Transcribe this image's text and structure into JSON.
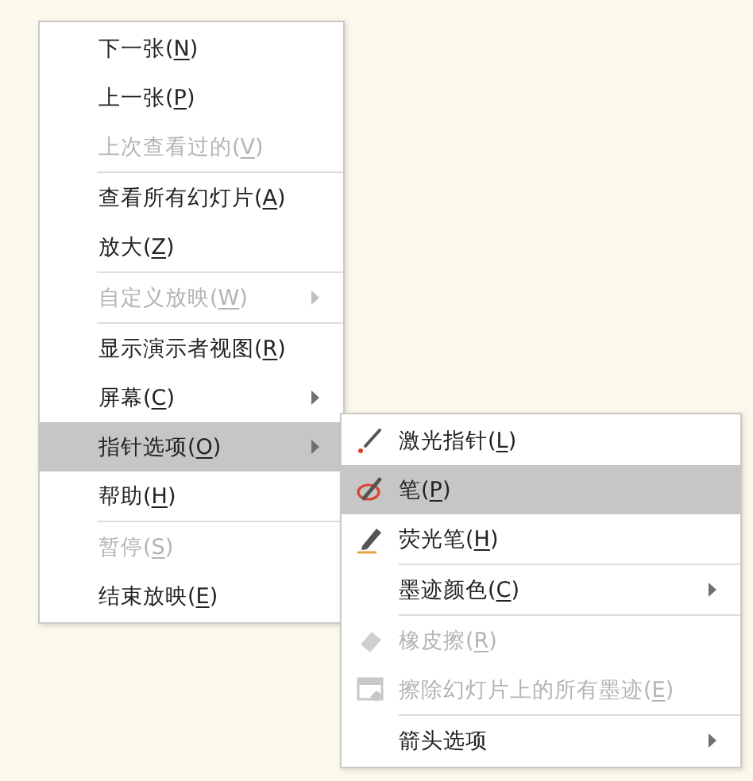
{
  "menu": {
    "items": [
      {
        "label": "下一张(N)",
        "disabled": false,
        "selected": false,
        "submenu": false
      },
      {
        "label": "上一张(P)",
        "disabled": false,
        "selected": false,
        "submenu": false
      },
      {
        "label": "上次查看过的(V)",
        "disabled": true,
        "selected": false,
        "submenu": false,
        "separator_after": true
      },
      {
        "label": "查看所有幻灯片(A)",
        "disabled": false,
        "selected": false,
        "submenu": false
      },
      {
        "label": "放大(Z)",
        "disabled": false,
        "selected": false,
        "submenu": false,
        "separator_after": true
      },
      {
        "label": "自定义放映(W)",
        "disabled": true,
        "selected": false,
        "submenu": true,
        "separator_after": true
      },
      {
        "label": "显示演示者视图(R)",
        "disabled": false,
        "selected": false,
        "submenu": false
      },
      {
        "label": "屏幕(C)",
        "disabled": false,
        "selected": false,
        "submenu": true
      },
      {
        "label": "指针选项(O)",
        "disabled": false,
        "selected": true,
        "submenu": true
      },
      {
        "label": "帮助(H)",
        "disabled": false,
        "selected": false,
        "submenu": false,
        "separator_after": true
      },
      {
        "label": "暂停(S)",
        "disabled": true,
        "selected": false,
        "submenu": false
      },
      {
        "label": "结束放映(E)",
        "disabled": false,
        "selected": false,
        "submenu": false
      }
    ]
  },
  "submenu": {
    "items": [
      {
        "kind": "laser",
        "label": "激光指针(L)",
        "disabled": false,
        "selected": false,
        "submenu": false
      },
      {
        "kind": "pen",
        "label": "笔(P)",
        "disabled": false,
        "selected": true,
        "submenu": false
      },
      {
        "kind": "highlighter",
        "label": "荧光笔(H)",
        "disabled": false,
        "selected": false,
        "submenu": false,
        "separator_after": true
      },
      {
        "kind": "plain",
        "label": "墨迹颜色(C)",
        "disabled": false,
        "selected": false,
        "submenu": true,
        "separator_after": true
      },
      {
        "kind": "eraser",
        "label": "橡皮擦(R)",
        "disabled": true,
        "selected": false,
        "submenu": false
      },
      {
        "kind": "erase-all",
        "label": "擦除幻灯片上的所有墨迹(E)",
        "disabled": true,
        "selected": false,
        "submenu": false,
        "separator_after": true
      },
      {
        "kind": "plain",
        "label": "箭头选项",
        "disabled": false,
        "selected": false,
        "submenu": true
      }
    ]
  }
}
